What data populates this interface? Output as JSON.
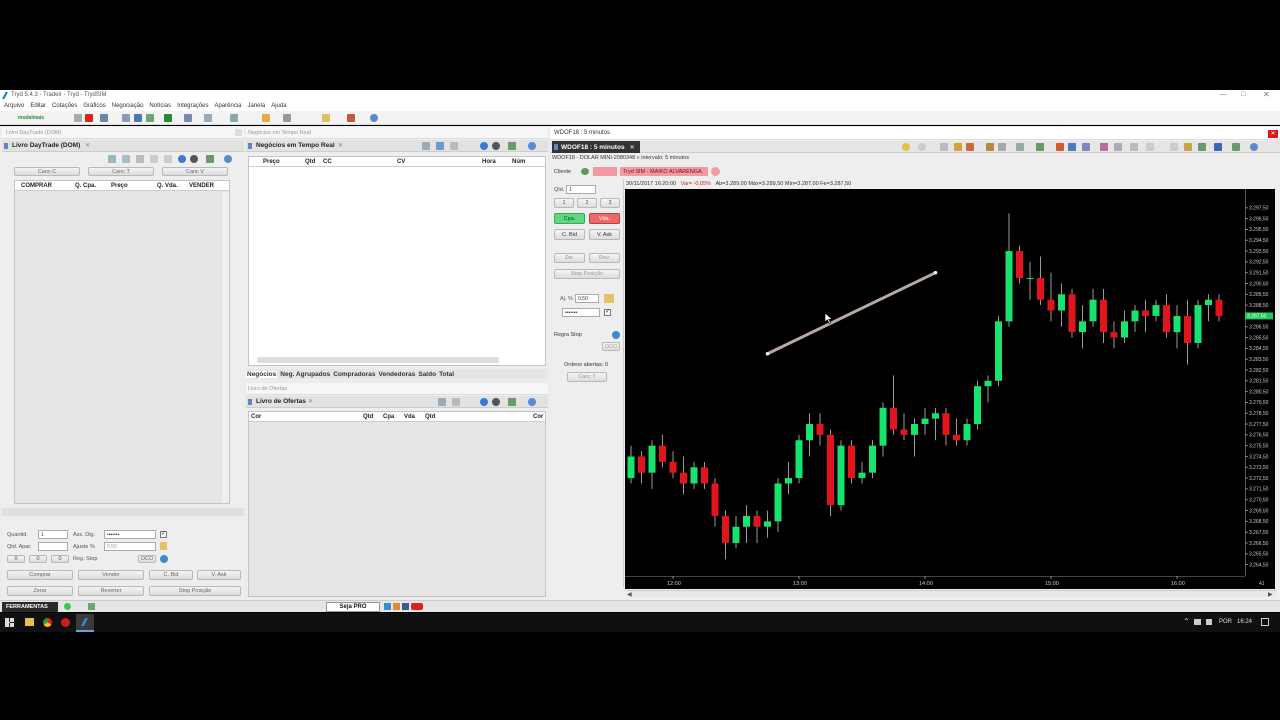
{
  "window": {
    "title": "Tryd 5.4.3 - Tradeir - Tryd - TrydSIM"
  },
  "menu": [
    "Arquivo",
    "Editar",
    "Cotações",
    "Gráficos",
    "Negociação",
    "Notícias",
    "Integrações",
    "Aparência",
    "Janela",
    "Ajuda"
  ],
  "toolbar": {
    "logo": "modalmais"
  },
  "dom": {
    "outer_title": "Livro DayTrade (DOM)",
    "tab": "Livro DayTrade (DOM)",
    "canc_c": "Canc C",
    "canc_t": "Canc T",
    "canc_v": "Canc V",
    "columns": [
      "COMPRAR",
      "Q. Cpa.",
      "Preço",
      "Q. Vda.",
      "VENDER"
    ],
    "quantid_label": "Quantid.",
    "quantid_value": "1",
    "ass_dig_label": "Ass. Dig.",
    "ass_dig_value": "•••••••",
    "qtd_apar_label": "Qtd. Apar.",
    "ajuste_label": "Ajuste %",
    "ajuste_value": "0,50",
    "reg_stop_label": "Reg. Stop",
    "oco": "OCO",
    "zeros": [
      "0",
      "0",
      "0"
    ],
    "buttons": {
      "comprar": "Comprar",
      "vender": "Vender",
      "cbid": "C. Bid",
      "vask": "V. Ask",
      "zerar": "Zerar",
      "reverter": "Reverter",
      "stop_posicao": "Stop Posição"
    }
  },
  "negocios": {
    "outer_title": "Negócios em Tempo Real",
    "tab": "Negócios em Tempo Real",
    "columns": [
      "Preço",
      "Qtd",
      "CC",
      "CV",
      "Hora",
      "Núm"
    ],
    "tabs": [
      "Negócios",
      "Neg. Agrupados",
      "Compradoras",
      "Vendedoras",
      "Saldo",
      "Total"
    ]
  },
  "ofertas": {
    "outer_title": "Livro de Ofertas",
    "tab": "Livro de Ofertas",
    "columns": [
      "Cor",
      "Qtd",
      "Cpa",
      "Vda",
      "Qtd",
      "Cor"
    ]
  },
  "chart_window": {
    "title": "WDOF18 : 5 minutos",
    "tab": "WDOF18 : 5 minutos",
    "subtitle": "WDOF18 - DOLAR MINI-2080348 » intervalo: 5 minutos",
    "cliente_label": "Cliente",
    "account": "Tryd SIM - MAIKO ALVARENGA",
    "info_date": "30/11/2017 16:20:00",
    "info_var": "Var= -0,05%",
    "info_rest": "Ab=3.289,00  Máx=3.289,50  Mín=3.287,00  Fe=3.287,50",
    "price_tag": "3.287,50",
    "corner_label": "41"
  },
  "boleta": {
    "qtd_label": "Qtd.",
    "qtd_value": "1",
    "q1": "1",
    "q2": "2",
    "q3": "3",
    "cpa": "Cpa.",
    "vda": "Vda.",
    "cbid": "C. Bid",
    "vask": "V. Ask",
    "zer": "Zer.",
    "rev": "Rev.",
    "stop_posicao": "Stop Posição",
    "aj_label": "Aj. %",
    "aj_value": "0,50",
    "pwd": "•••••••",
    "regra_stop": "Regra Stop",
    "oco": "OCO",
    "ordens": "Ordens abertas: 0",
    "canc_t": "Canc T"
  },
  "statusbar": {
    "ferramentas": "FERRAMENTAS",
    "seja_pro": "Seja PRO"
  },
  "taskbar": {
    "lang": "POR",
    "time": "16:24"
  },
  "chart_data": {
    "type": "candlestick",
    "title": "",
    "ylim": [
      3264.0,
      3298.5
    ],
    "y_ticks": [
      3297.5,
      3296.5,
      3295.5,
      3294.5,
      3293.5,
      3292.5,
      3291.5,
      3290.5,
      3289.5,
      3288.5,
      3287.5,
      3286.5,
      3285.5,
      3284.5,
      3283.5,
      3282.5,
      3281.5,
      3280.5,
      3279.5,
      3278.5,
      3277.5,
      3276.5,
      3275.5,
      3274.5,
      3273.5,
      3272.5,
      3271.5,
      3270.5,
      3269.5,
      3268.5,
      3267.5,
      3266.5,
      3265.5,
      3264.5
    ],
    "y_tick_labels": [
      "3.297,50",
      "3.296,50",
      "3.295,50",
      "3.294,50",
      "3.293,50",
      "3.292,50",
      "3.291,50",
      "3.290,50",
      "3.289,50",
      "3.288,50",
      "3.287,50",
      "3.286,50",
      "3.285,50",
      "3.284,50",
      "3.283,50",
      "3.282,50",
      "3.281,50",
      "3.280,50",
      "3.279,50",
      "3.278,50",
      "3.277,50",
      "3.276,50",
      "3.275,50",
      "3.274,50",
      "3.273,50",
      "3.272,50",
      "3.271,50",
      "3.270,50",
      "3.269,50",
      "3.268,50",
      "3.267,50",
      "3.266,50",
      "3.265,50",
      "3.264,50"
    ],
    "x_tick_labels": [
      "12:00",
      "13:00",
      "14:00",
      "15:00",
      "16:00"
    ],
    "x_tick_index": [
      4,
      16,
      28,
      40,
      52
    ],
    "candles": [
      {
        "o": 3272.5,
        "h": 3275.5,
        "l": 3272.0,
        "c": 3274.5
      },
      {
        "o": 3274.5,
        "h": 3275.0,
        "l": 3272.0,
        "c": 3273.0
      },
      {
        "o": 3273.0,
        "h": 3276.0,
        "l": 3271.5,
        "c": 3275.5
      },
      {
        "o": 3275.5,
        "h": 3276.5,
        "l": 3273.5,
        "c": 3274.0
      },
      {
        "o": 3274.0,
        "h": 3275.0,
        "l": 3272.5,
        "c": 3273.0
      },
      {
        "o": 3273.0,
        "h": 3274.5,
        "l": 3271.0,
        "c": 3272.0
      },
      {
        "o": 3272.0,
        "h": 3274.0,
        "l": 3271.5,
        "c": 3273.5
      },
      {
        "o": 3273.5,
        "h": 3274.0,
        "l": 3271.5,
        "c": 3272.0
      },
      {
        "o": 3272.0,
        "h": 3272.5,
        "l": 3268.0,
        "c": 3269.0
      },
      {
        "o": 3269.0,
        "h": 3269.5,
        "l": 3265.0,
        "c": 3266.5
      },
      {
        "o": 3266.5,
        "h": 3269.0,
        "l": 3266.0,
        "c": 3268.0
      },
      {
        "o": 3268.0,
        "h": 3270.0,
        "l": 3266.5,
        "c": 3269.0
      },
      {
        "o": 3269.0,
        "h": 3269.5,
        "l": 3266.5,
        "c": 3268.0
      },
      {
        "o": 3268.0,
        "h": 3269.5,
        "l": 3267.0,
        "c": 3268.5
      },
      {
        "o": 3268.5,
        "h": 3272.5,
        "l": 3267.5,
        "c": 3272.0
      },
      {
        "o": 3272.0,
        "h": 3274.0,
        "l": 3271.0,
        "c": 3272.5
      },
      {
        "o": 3272.5,
        "h": 3276.5,
        "l": 3272.0,
        "c": 3276.0
      },
      {
        "o": 3276.0,
        "h": 3278.5,
        "l": 3274.5,
        "c": 3277.5
      },
      {
        "o": 3277.5,
        "h": 3278.5,
        "l": 3275.5,
        "c": 3276.5
      },
      {
        "o": 3276.5,
        "h": 3277.0,
        "l": 3269.0,
        "c": 3270.0
      },
      {
        "o": 3270.0,
        "h": 3276.0,
        "l": 3269.5,
        "c": 3275.5
      },
      {
        "o": 3275.5,
        "h": 3276.0,
        "l": 3272.0,
        "c": 3272.5
      },
      {
        "o": 3272.5,
        "h": 3274.0,
        "l": 3272.0,
        "c": 3273.0
      },
      {
        "o": 3273.0,
        "h": 3276.0,
        "l": 3272.5,
        "c": 3275.5
      },
      {
        "o": 3275.5,
        "h": 3279.5,
        "l": 3274.5,
        "c": 3279.0
      },
      {
        "o": 3279.0,
        "h": 3282.0,
        "l": 3276.5,
        "c": 3277.0
      },
      {
        "o": 3277.0,
        "h": 3278.5,
        "l": 3276.0,
        "c": 3276.5
      },
      {
        "o": 3276.5,
        "h": 3278.0,
        "l": 3274.5,
        "c": 3277.5
      },
      {
        "o": 3277.5,
        "h": 3279.0,
        "l": 3276.5,
        "c": 3278.0
      },
      {
        "o": 3278.0,
        "h": 3279.0,
        "l": 3276.0,
        "c": 3278.5
      },
      {
        "o": 3278.5,
        "h": 3279.0,
        "l": 3275.5,
        "c": 3276.5
      },
      {
        "o": 3276.5,
        "h": 3278.0,
        "l": 3275.5,
        "c": 3276.0
      },
      {
        "o": 3276.0,
        "h": 3278.0,
        "l": 3275.5,
        "c": 3277.5
      },
      {
        "o": 3277.5,
        "h": 3281.5,
        "l": 3277.0,
        "c": 3281.0
      },
      {
        "o": 3281.0,
        "h": 3282.0,
        "l": 3279.5,
        "c": 3281.5
      },
      {
        "o": 3281.5,
        "h": 3287.5,
        "l": 3281.0,
        "c": 3287.0
      },
      {
        "o": 3287.0,
        "h": 3297.0,
        "l": 3286.5,
        "c": 3293.5
      },
      {
        "o": 3293.5,
        "h": 3294.0,
        "l": 3290.5,
        "c": 3291.0
      },
      {
        "o": 3291.0,
        "h": 3292.5,
        "l": 3289.0,
        "c": 3291.0
      },
      {
        "o": 3291.0,
        "h": 3293.0,
        "l": 3288.5,
        "c": 3289.0
      },
      {
        "o": 3289.0,
        "h": 3291.5,
        "l": 3287.0,
        "c": 3288.0
      },
      {
        "o": 3288.0,
        "h": 3290.5,
        "l": 3286.5,
        "c": 3289.5
      },
      {
        "o": 3289.5,
        "h": 3290.0,
        "l": 3285.5,
        "c": 3286.0
      },
      {
        "o": 3286.0,
        "h": 3288.5,
        "l": 3284.5,
        "c": 3287.0
      },
      {
        "o": 3287.0,
        "h": 3290.0,
        "l": 3286.5,
        "c": 3289.0
      },
      {
        "o": 3289.0,
        "h": 3290.0,
        "l": 3285.0,
        "c": 3286.0
      },
      {
        "o": 3286.0,
        "h": 3287.0,
        "l": 3284.5,
        "c": 3285.5
      },
      {
        "o": 3285.5,
        "h": 3288.0,
        "l": 3285.0,
        "c": 3287.0
      },
      {
        "o": 3287.0,
        "h": 3288.5,
        "l": 3286.0,
        "c": 3288.0
      },
      {
        "o": 3288.0,
        "h": 3289.0,
        "l": 3286.0,
        "c": 3287.5
      },
      {
        "o": 3287.5,
        "h": 3289.0,
        "l": 3287.0,
        "c": 3288.5
      },
      {
        "o": 3288.5,
        "h": 3289.5,
        "l": 3285.5,
        "c": 3286.0
      },
      {
        "o": 3286.0,
        "h": 3288.5,
        "l": 3284.5,
        "c": 3287.5
      },
      {
        "o": 3287.5,
        "h": 3289.0,
        "l": 3283.0,
        "c": 3285.0
      },
      {
        "o": 3285.0,
        "h": 3289.0,
        "l": 3284.5,
        "c": 3288.5
      },
      {
        "o": 3288.5,
        "h": 3289.5,
        "l": 3287.0,
        "c": 3289.0
      },
      {
        "o": 3289.0,
        "h": 3289.5,
        "l": 3287.0,
        "c": 3287.5
      }
    ],
    "trendline": {
      "from_index": 13,
      "from_price": 3284.0,
      "to_index": 29,
      "to_price": 3291.5
    },
    "colors": {
      "up": "#17e36f",
      "down": "#e2141c",
      "background": "#000000",
      "trendline": "#b8a6a8"
    }
  }
}
